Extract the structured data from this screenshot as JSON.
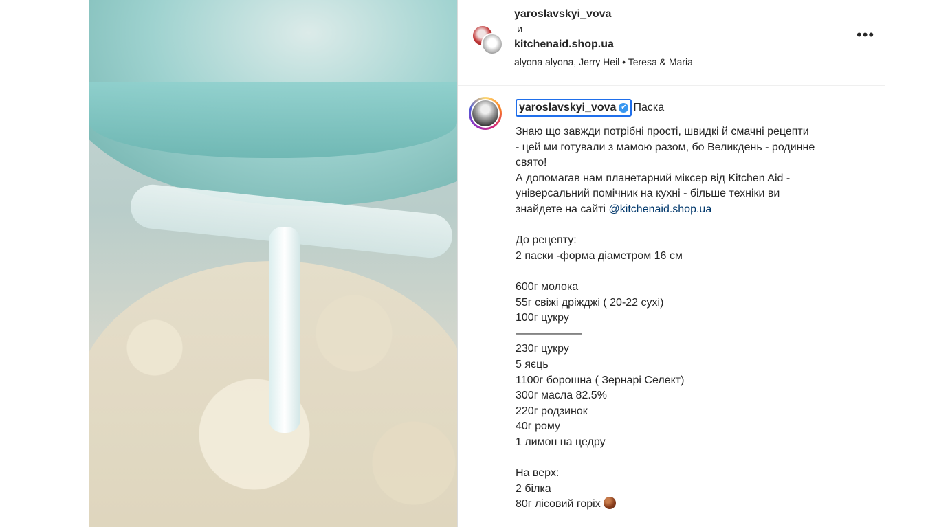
{
  "header": {
    "user1": "yaroslavskyi_vova",
    "conjunction": "и",
    "user2": "kitchenaid.shop.ua",
    "audio": "alyona alyona, Jerry Heil • Teresa & Maria",
    "more_glyph": "•••"
  },
  "caption": {
    "username": "yaroslavskyi_vova",
    "verified_glyph": "✔",
    "title": "Паска",
    "intro": "Знаю що завжди потрібні прості, швидкі й смачні рецепти\n- цей ми готували з мамою разом, бо Великдень - родинне\nсвято!\nА допомагав нам планетарний міксер від Kitchen Aid -\nуніверсальний помічник на кухні - більше техніки ви\nзнайдете на сайті ",
    "mention": "@kitchenaid.shop.ua",
    "recipe": "\n\nДо рецепту:\n2 паски -форма діаметром 16 см\n\n600г молока\n55г свіжі дріжджі ( 20-22 сухі)\n100г цукру\n——————\n230г цукру\n5 яєць\n1100г борошна ( Зернарі Селект)\n300г масла 82.5%\n220г родзинок\n40г рому\n1 лимон на цедру\n\nНа верх:\n2 білка\n80г лісовий горіх"
  },
  "icons": {
    "more": "more-icon",
    "verified": "verified-icon",
    "hazelnut": "hazelnut-emoji"
  }
}
